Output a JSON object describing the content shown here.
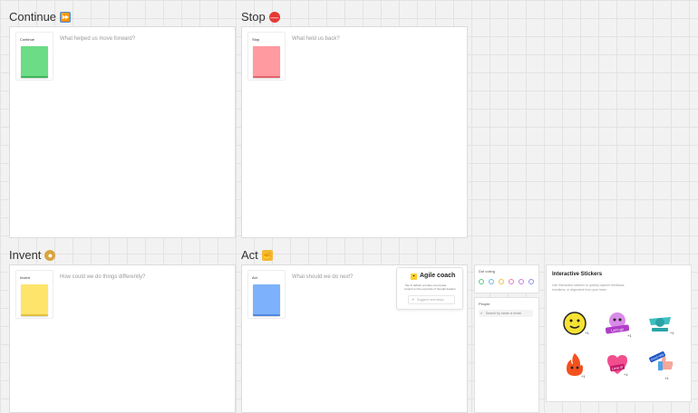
{
  "sections": {
    "continue": {
      "title": "Continue",
      "note_label": "Continue",
      "prompt": "What helped us move forward?",
      "color": "#6ddc86"
    },
    "stop": {
      "title": "Stop",
      "note_label": "Stop",
      "prompt": "What held us back?",
      "color": "#ff9aa0"
    },
    "invent": {
      "title": "Invent",
      "note_label": "Invent",
      "prompt": "How could we do things differently?",
      "color": "#ffe46b"
    },
    "act": {
      "title": "Act",
      "note_label": "Act",
      "prompt": "What should we do next?",
      "color": "#7eb1fb"
    }
  },
  "agile_coach": {
    "title": "Agile coach",
    "description_line1": "Tap & Jalbeth provides smart,idea.",
    "description_line2": "ccoach on the expertise of thought leaders.",
    "input_placeholder": "Suggest next steps"
  },
  "dot_voting": {
    "label": "Dot voting",
    "colors": [
      "#5cc878",
      "#6ab7e8",
      "#f2c23c",
      "#f27bb0",
      "#c77be8",
      "#8a8ff0"
    ]
  },
  "people": {
    "label": "People",
    "search_placeholder": "Search by name or email"
  },
  "stickers": {
    "title": "Interactive Stickers",
    "description_line1": "Use interactive stickers to quickly capture feedback,",
    "description_line2": "emotions, or alignment from your team",
    "items": [
      {
        "name": "smiley",
        "count": "+1"
      },
      {
        "name": "lets-go-monster",
        "count": "+1",
        "text": "Let's go"
      },
      {
        "name": "teal-ribbon",
        "count": "+1"
      },
      {
        "name": "fire",
        "count": "+1"
      },
      {
        "name": "love-it-heart",
        "count": "+1",
        "text": "Love it!"
      },
      {
        "name": "good-idea-thumb",
        "count": "+1",
        "text": "Good idea"
      }
    ]
  }
}
